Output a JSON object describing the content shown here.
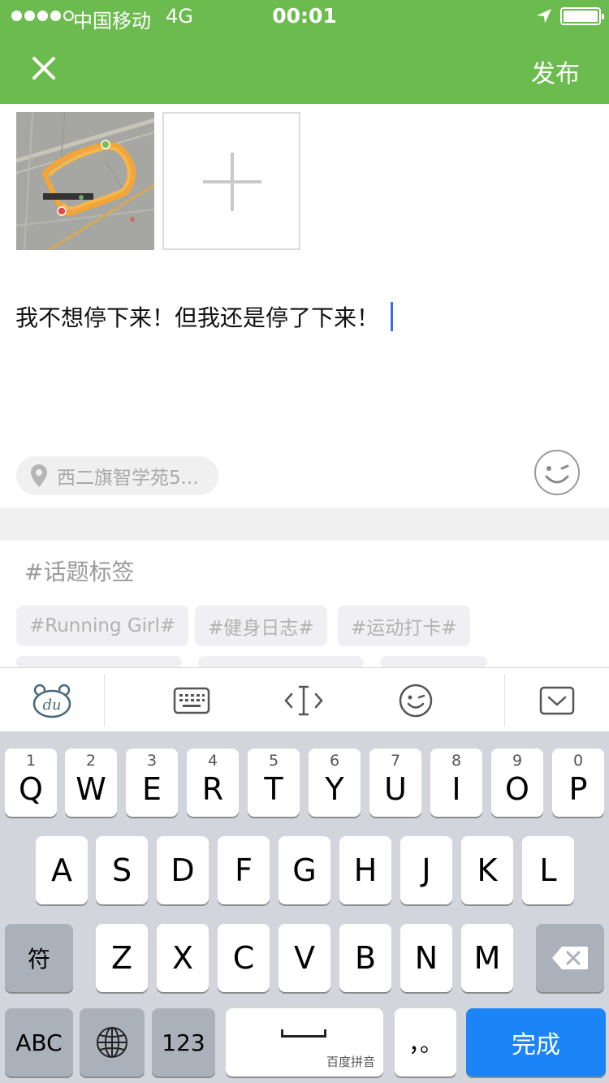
{
  "status_bar": {
    "carrier": "中国移动",
    "network": "4G",
    "time": "00:01",
    "signal_bars_filled": 4,
    "signal_bars_total": 5
  },
  "header": {
    "publish_label": "发布",
    "close_icon": "close-icon"
  },
  "post": {
    "text": "我不想停下来！但我还是停了下来！"
  },
  "location": {
    "text": "西二旗智学苑5..."
  },
  "tags": {
    "title": "#话题标签",
    "items": [
      "#Running Girl#",
      "#健身日志#",
      "#运动打卡#"
    ]
  },
  "keyboard": {
    "row1": [
      {
        "num": "1",
        "letter": "Q"
      },
      {
        "num": "2",
        "letter": "W"
      },
      {
        "num": "3",
        "letter": "E"
      },
      {
        "num": "4",
        "letter": "R"
      },
      {
        "num": "5",
        "letter": "T"
      },
      {
        "num": "6",
        "letter": "Y"
      },
      {
        "num": "7",
        "letter": "U"
      },
      {
        "num": "8",
        "letter": "I"
      },
      {
        "num": "9",
        "letter": "O"
      },
      {
        "num": "0",
        "letter": "P"
      }
    ],
    "row2": [
      "A",
      "S",
      "D",
      "F",
      "G",
      "H",
      "J",
      "K",
      "L"
    ],
    "row3": [
      "Z",
      "X",
      "C",
      "V",
      "B",
      "N",
      "M"
    ],
    "symbol_key": "符",
    "abc_key": "ABC",
    "num_key": "123",
    "space_sublabel": "百度拼音",
    "punct_key": "，。",
    "done_key": "完成"
  },
  "colors": {
    "header_green": "#6cbb4e",
    "done_blue": "#1b84f6",
    "caret_blue": "#3a6fe0"
  }
}
